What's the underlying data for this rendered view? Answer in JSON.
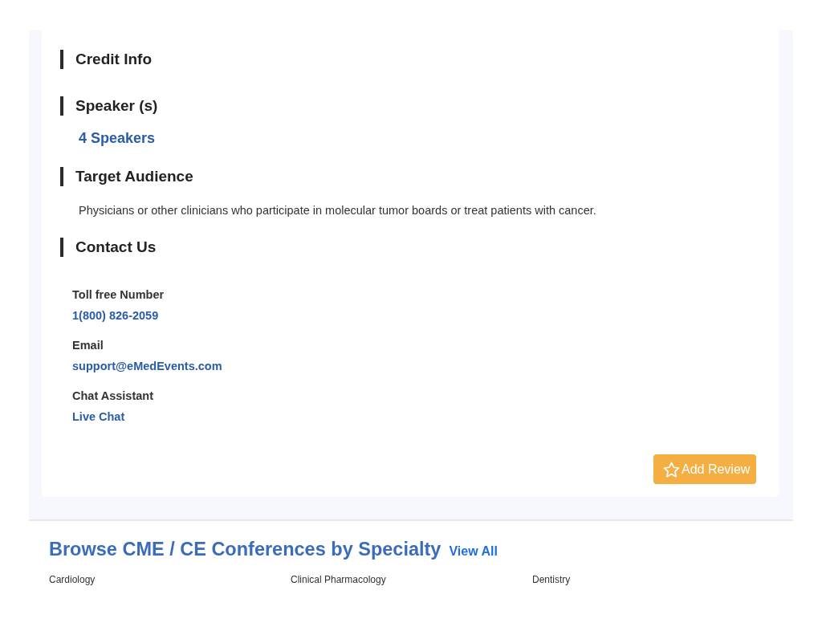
{
  "sections": [
    {
      "title": "Credit Info"
    },
    {
      "title": "Speaker (s)",
      "link": "4 Speakers"
    },
    {
      "title": "Target Audience",
      "text": "Physicians or other clinicians who participate in molecular tumor boards or treat patients with cancer."
    },
    {
      "title": "Contact Us",
      "contacts": [
        {
          "label": "Toll free Number",
          "value": "1(800) 826-2059"
        },
        {
          "label": "Email",
          "value": "support@eMedEvents.com"
        },
        {
          "label": "Chat Assistant",
          "value": "Live Chat"
        }
      ]
    }
  ],
  "review_button": {
    "label": "Add Review"
  },
  "browse": {
    "title": "Browse CME / CE Conferences by Specialty",
    "view_all": "View All",
    "specialties": [
      "Cardiology",
      "Clinical Pharmacology",
      "Dentistry"
    ]
  }
}
